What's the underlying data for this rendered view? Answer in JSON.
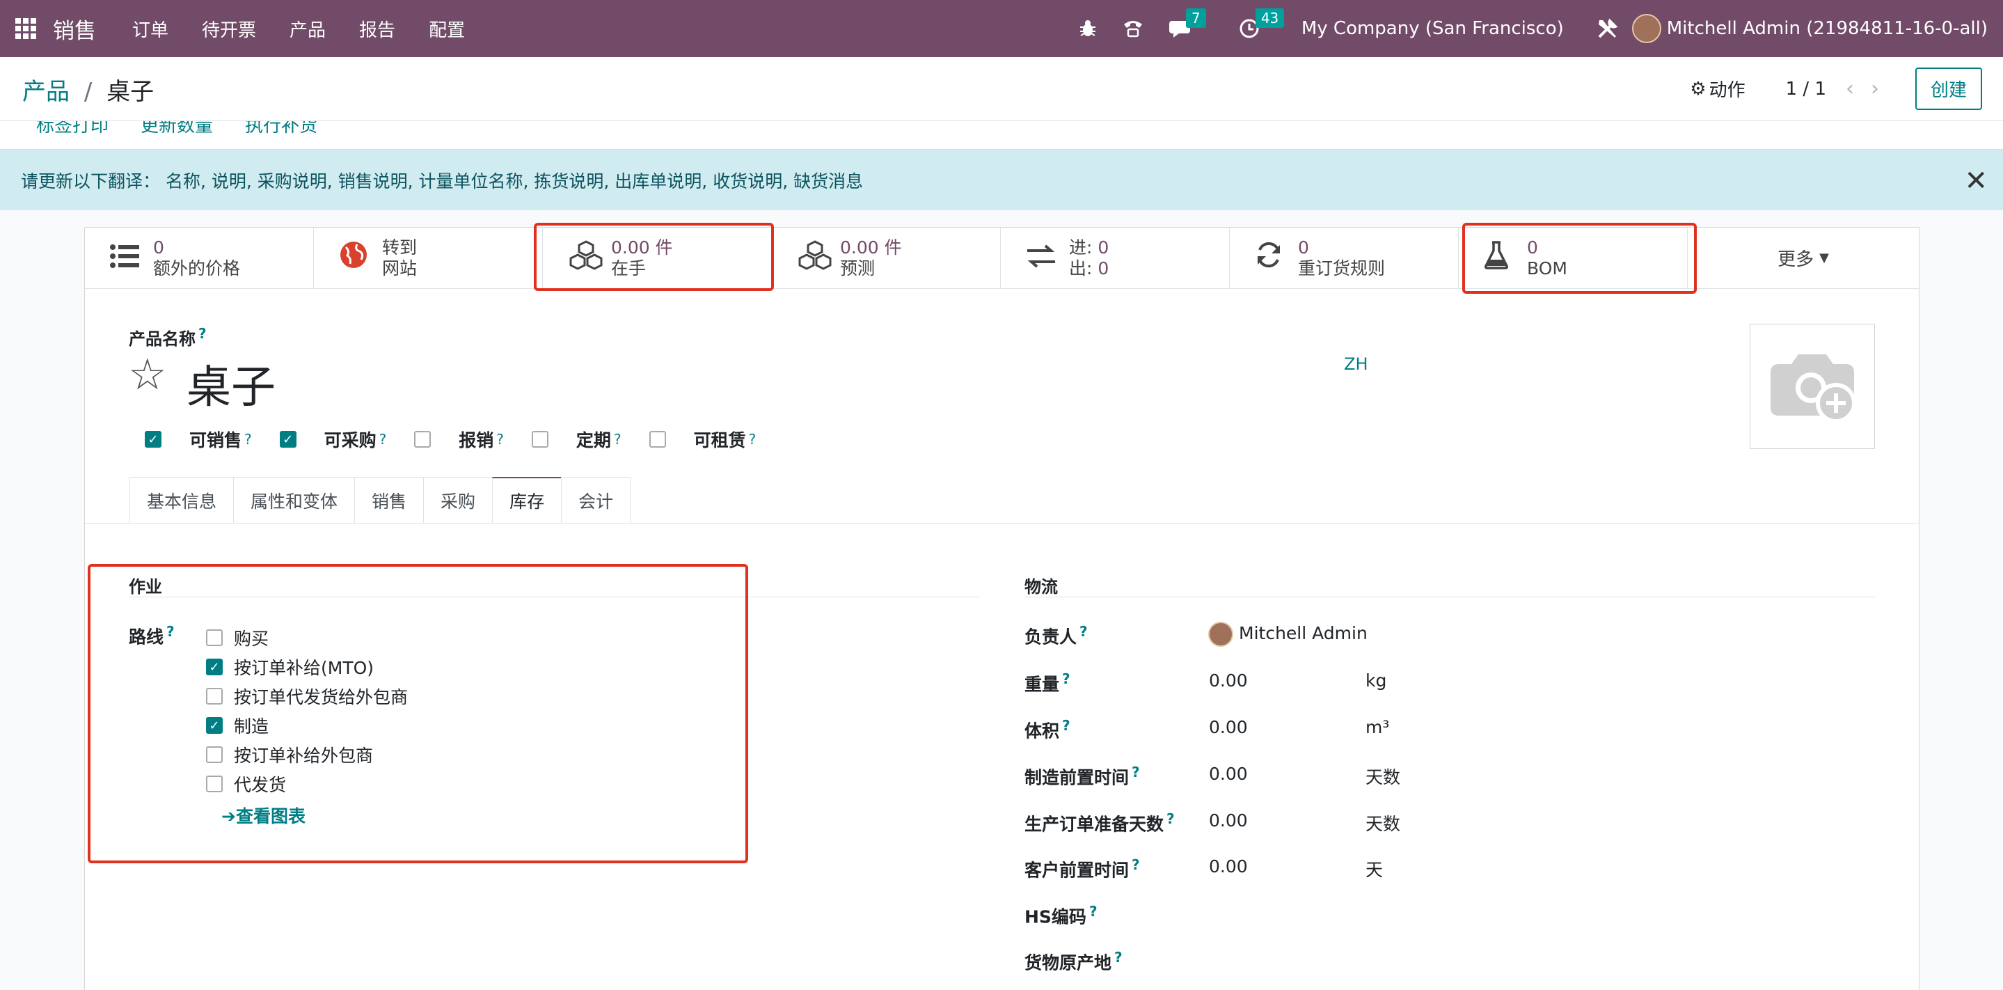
{
  "navbar": {
    "app_name": "销售",
    "menu": [
      "订单",
      "待开票",
      "产品",
      "报告",
      "配置"
    ],
    "messages_count": "7",
    "activities_count": "43",
    "company": "My Company (San Francisco)",
    "user": "Mitchell Admin (21984811-16-0-all)",
    "bg_color": "#714b67"
  },
  "control_panel": {
    "breadcrumb_parent": "产品",
    "breadcrumb_sep": "/",
    "breadcrumb_current": "桌子",
    "action_label": "动作",
    "pager": "1 / 1",
    "create_label": "创建"
  },
  "header_buttons": [
    "标签打印",
    "更新数量",
    "执行补货"
  ],
  "alert": {
    "text": "请更新以下翻译： 名称, 说明, 采购说明, 销售说明, 计量单位名称, 拣货说明, 出库单说明, 收货说明, 缺货消息"
  },
  "stat_buttons": [
    {
      "icon": "list-icon",
      "value": "0",
      "label": "额外的价格"
    },
    {
      "icon": "globe-icon",
      "value": "转到",
      "label": "网站"
    },
    {
      "icon": "cubes-icon",
      "value": "0.00 件",
      "label": "在手"
    },
    {
      "icon": "cubes-icon",
      "value": "0.00 件",
      "label": "预测"
    },
    {
      "icon": "exchange-icon",
      "value_in": "进:",
      "in": "0",
      "value_out": "出:",
      "out": "0"
    },
    {
      "icon": "refresh-icon",
      "value": "0",
      "label": "重订货规则"
    },
    {
      "icon": "flask-icon",
      "value": "0",
      "label": "BOM"
    }
  ],
  "more_label": "更多",
  "product": {
    "name_label": "产品名称",
    "name": "桌子",
    "lang": "ZH",
    "options": [
      {
        "label": "可销售",
        "checked": true
      },
      {
        "label": "可采购",
        "checked": true
      },
      {
        "label": "报销",
        "checked": false
      },
      {
        "label": "定期",
        "checked": false
      },
      {
        "label": "可租赁",
        "checked": false
      }
    ]
  },
  "tabs": [
    "基本信息",
    "属性和变体",
    "销售",
    "采购",
    "库存",
    "会计"
  ],
  "active_tab": "库存",
  "operations": {
    "title": "作业",
    "route_label": "路线",
    "routes": [
      {
        "label": "购买",
        "checked": false
      },
      {
        "label": "按订单补给(MTO)",
        "checked": true
      },
      {
        "label": "按订单代发货给外包商",
        "checked": false
      },
      {
        "label": "制造",
        "checked": true
      },
      {
        "label": "按订单补给外包商",
        "checked": false
      },
      {
        "label": "代发货",
        "checked": false
      }
    ],
    "chart_link": "查看图表"
  },
  "logistics": {
    "title": "物流",
    "responsible_label": "负责人",
    "responsible": "Mitchell Admin",
    "fields": [
      {
        "label": "重量",
        "value": "0.00",
        "unit": "kg"
      },
      {
        "label": "体积",
        "value": "0.00",
        "unit": "m³"
      },
      {
        "label": "制造前置时间",
        "value": "0.00",
        "unit": "天数"
      },
      {
        "label": "生产订单准备天数",
        "value": "0.00",
        "unit": "天数"
      },
      {
        "label": "客户前置时间",
        "value": "0.00",
        "unit": "天"
      }
    ],
    "hs_label": "HS编码",
    "origin_label": "货物原产地"
  }
}
